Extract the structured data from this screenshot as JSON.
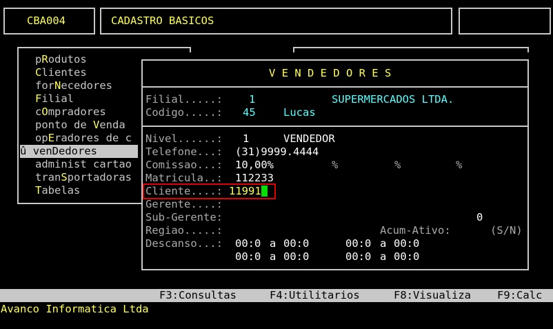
{
  "header": {
    "program_code": "CBA004",
    "title": "CADASTRO BASICOS"
  },
  "menu": {
    "items": [
      {
        "pre": "p",
        "key": "R",
        "post": "odutos"
      },
      {
        "pre": "",
        "key": "C",
        "post": "lientes"
      },
      {
        "pre": "for",
        "key": "N",
        "post": "ecedores"
      },
      {
        "pre": "",
        "key": "F",
        "post": "ilial"
      },
      {
        "pre": "c",
        "key": "O",
        "post": "mpradores"
      },
      {
        "pre": "ponto de ",
        "key": "V",
        "post": "enda"
      },
      {
        "pre": "op",
        "key": "E",
        "post": "radores de c"
      },
      {
        "pre": "ven",
        "key": "D",
        "post": "edores"
      },
      {
        "pre": "administ cartao",
        "key": "",
        "post": ""
      },
      {
        "pre": "tran",
        "key": "S",
        "post": "portadoras"
      },
      {
        "pre": "",
        "key": "T",
        "post": "abelas"
      }
    ],
    "selected_marker": "û",
    "selected_label": "venDedores"
  },
  "dialog": {
    "title": "V E N D E D O R E S",
    "filial_label": "Filial.....:",
    "filial_value": "1",
    "filial_name": "SUPERMERCADOS LTDA.",
    "codigo_label": "Codigo.....:",
    "codigo_value": "45",
    "codigo_name": "Lucas",
    "nivel_label": "Nivel......:",
    "nivel_value": "1",
    "nivel_desc": "VENDEDOR",
    "telefone_label": "Telefone...:",
    "telefone_value": "(31)9999.4444",
    "comissao_label": "Comissao...:",
    "comissao_value": "10,00%",
    "pct1": "%",
    "pct2": "%",
    "pct3": "%",
    "matricula_label": "Matricula..:",
    "matricula_value": "112233",
    "cliente_label": "Cliente....:",
    "cliente_value": "11991",
    "gerente_label": "Gerente....:",
    "subgerente_label": "Sub-Gerente:",
    "subgerente_value": "0",
    "regiao_label": "Regiao.....:",
    "acum_label": "Acum-Ativo:",
    "acum_options": "(S/N)",
    "descanso_label": "Descanso...:",
    "descanso": [
      [
        "00:0",
        "a",
        "00:0",
        "00:0",
        "a",
        "00:0"
      ],
      [
        "00:0",
        "a",
        "00:0",
        "00:0",
        "a",
        "00:0"
      ]
    ]
  },
  "statusbar": {
    "f3": "F3:Consultas",
    "f4": "F4:Utilitarios",
    "f8": "F8:Visualiza",
    "f9": "F9:Calc"
  },
  "footer": {
    "company": "Avanco Informatica Ltda"
  },
  "colors": {
    "background": "#000000",
    "frame": "#c8c8c8",
    "highlight_text": "#ffff55",
    "value_text": "#55ffff",
    "cursor": "#00e000",
    "focus_border": "#e00000"
  }
}
